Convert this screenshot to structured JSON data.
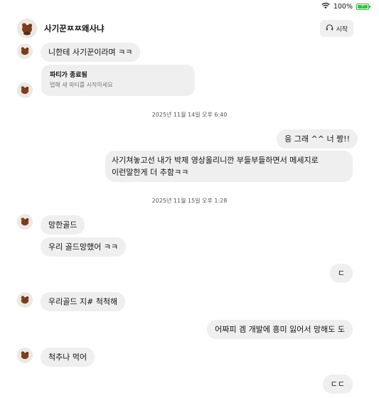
{
  "status": {
    "battery_pct": "100%",
    "battery_level": 1.0
  },
  "header": {
    "name": "사기꾼ㅉㅉ왜사냐",
    "call_label": "시작"
  },
  "messages_left_top": {
    "text": "니한테 사기꾼이라며 ㅋㅋ"
  },
  "party": {
    "title": "파티가 종료됨",
    "subtitle": "탭해 새 파티를 시작하세요"
  },
  "timestamps": [
    "2025년 11월 14일 오후 6:40",
    "2025년 11월 15일 오후 1:28"
  ],
  "right_1": {
    "text": "응 그래 ^^ 너 짱!!"
  },
  "right_2": {
    "text": "사기쳐놓고선 내가 박제 영상올리니깐 부들부들하면서 메세지로\n이런말한게 더 추함ㅋㅋ"
  },
  "left_1": {
    "text": "망한골드"
  },
  "left_2": {
    "text": "우리 골드망했어 ㅋㅋ"
  },
  "right_3": {
    "text": "ㄷ"
  },
  "left_3": {
    "text": "우리골드 지# 척척해"
  },
  "right_4": {
    "text": "어짜피 겜 개발에 흥미 잃어서 망해도 도"
  },
  "left_4": {
    "text": "척추나 먹어"
  },
  "right_5": {
    "text": "ㄷㄷ"
  },
  "colors": {
    "bubble": "#efefef",
    "battery": "#25c940"
  }
}
